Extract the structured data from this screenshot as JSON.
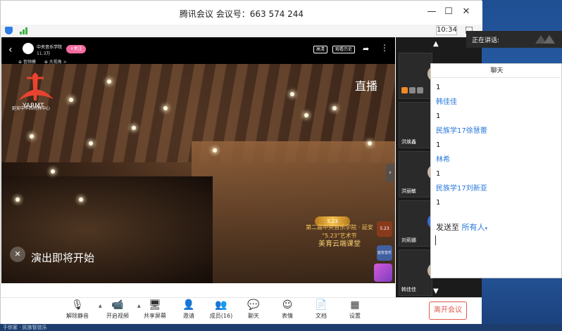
{
  "window": {
    "title": "腾讯会议 会议号：663 574 244",
    "clock": "10:34"
  },
  "video": {
    "channel_name": "中央音乐学院",
    "channel_fans": "11.3万",
    "follow": "+关注",
    "tag_hd": "高清",
    "tag_history": "观看历史",
    "sublink_1": "⊕ 音频模",
    "sublink_2": "⊕ 大视角 >",
    "live": "直播",
    "caption": "演出即将开始",
    "logo_text": "延安中华西特林中心",
    "logo_brand": "YARMT",
    "promo_badge": "5.23",
    "promo_line1": "第二届中央音乐学院 · 延安",
    "promo_line2": "\"5.23\"艺术节",
    "promo_line3": "美育云端课堂",
    "promo_side_1": "5.23",
    "promo_side_2": "延安音乐节"
  },
  "speaking": {
    "label": "正在讲话:"
  },
  "thumbnails": [
    {
      "name": "洪焕鑫"
    },
    {
      "name": "洪丽敏"
    },
    {
      "name": "刘莉娜"
    },
    {
      "name": "韩佳佳"
    }
  ],
  "chat": {
    "header": "聊天",
    "messages": [
      {
        "kind": "text",
        "value": "1"
      },
      {
        "kind": "sender",
        "value": "韩佳佳"
      },
      {
        "kind": "text",
        "value": "1"
      },
      {
        "kind": "sender",
        "value": "民族学17徐慧蕾"
      },
      {
        "kind": "text",
        "value": "1"
      },
      {
        "kind": "sender",
        "value": "林希"
      },
      {
        "kind": "text",
        "value": "1"
      },
      {
        "kind": "sender",
        "value": "民族学17刘新亚"
      },
      {
        "kind": "text",
        "value": "1"
      }
    ],
    "send_to_label": "发送至",
    "send_to_target": "所有人",
    "send_to_caret": "▾"
  },
  "toolbar": {
    "mute": "解除静音",
    "video": "开启视频",
    "share": "共享屏幕",
    "invite": "邀请",
    "members": "成员(16)",
    "chat": "聊天",
    "emoji": "表情",
    "docs": "文档",
    "settings": "设置",
    "leave": "离开会议"
  },
  "taskbar": {
    "text": "于你家 · 民族管弦乐"
  },
  "colors": {
    "accent": "#2878d8",
    "leave": "#e25a4e",
    "follow": "#f46aa0",
    "signal": "#3cb043"
  }
}
